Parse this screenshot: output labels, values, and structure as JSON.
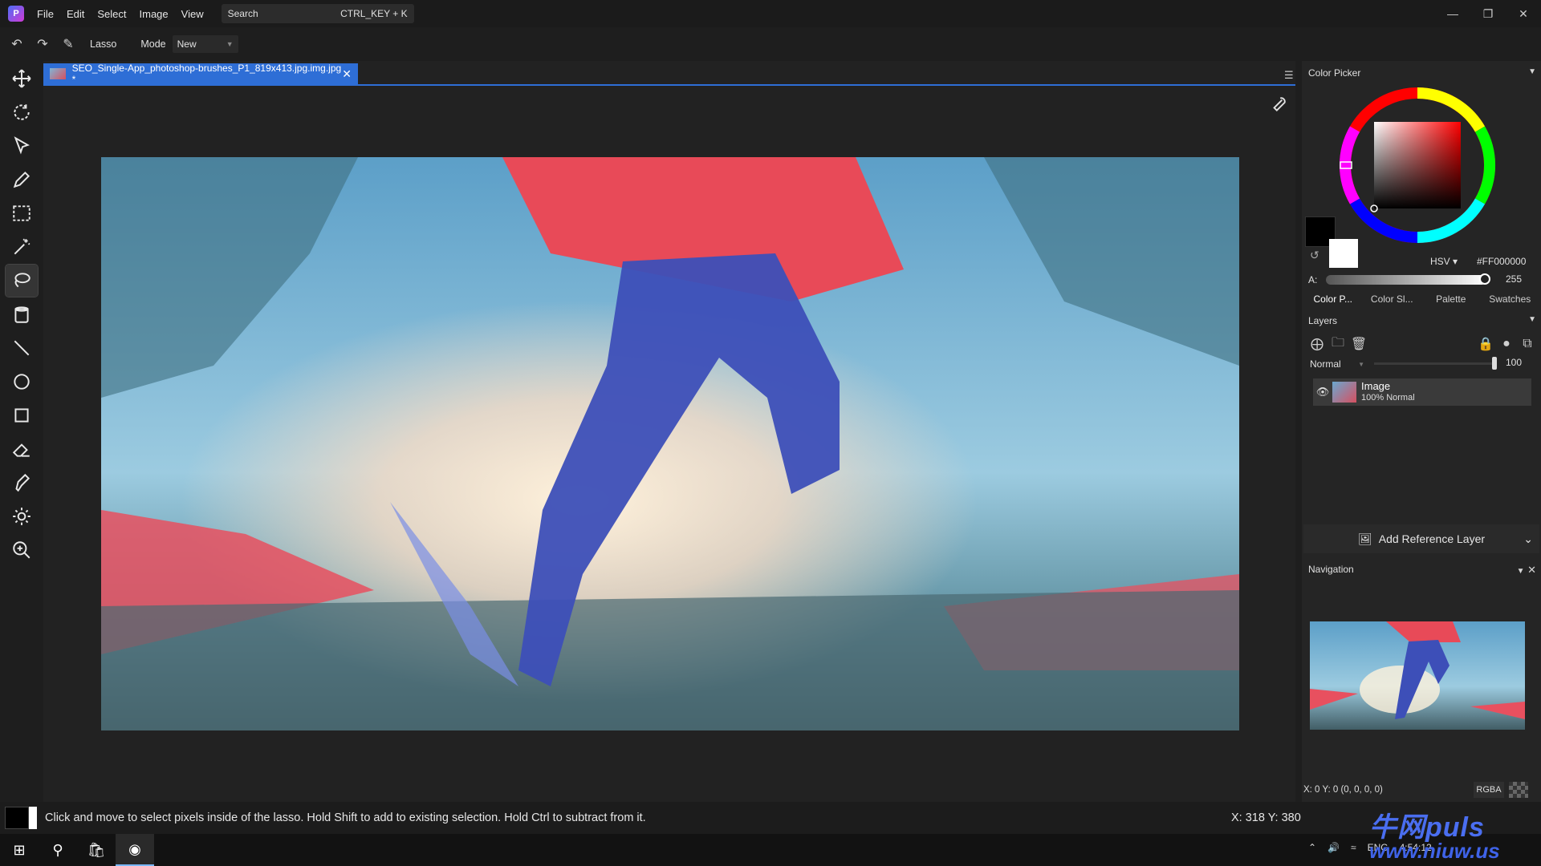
{
  "menu": {
    "items": [
      "File",
      "Edit",
      "Select",
      "Image",
      "View"
    ],
    "search_label": "Search",
    "search_shortcut": "CTRL_KEY + K"
  },
  "options": {
    "tool_name": "Lasso",
    "mode_label": "Mode",
    "mode_value": "New"
  },
  "tools": [
    "move-icon",
    "lasso-rotate-icon",
    "pointer-icon",
    "pencil-icon",
    "rect-select-icon",
    "magic-wand-icon",
    "lasso-icon",
    "bucket-icon",
    "line-icon",
    "ellipse-icon",
    "rectangle-icon",
    "eraser-icon",
    "pen-icon",
    "brightness-icon",
    "zoom-icon"
  ],
  "document": {
    "tab_title": "SEO_Single-App_photoshop-brushes_P1_819x413.jpg.img.jpg *",
    "tab_close": "✕"
  },
  "color_picker": {
    "title": "Color Picker",
    "mode": "HSV",
    "hex": "#FF000000",
    "alpha_label": "A:",
    "alpha_value": "255",
    "alpha_fraction": 1.0,
    "tabs": [
      "Color P...",
      "Color Sl...",
      "Palette",
      "Swatches"
    ],
    "foreground": "#000000",
    "background": "#ffffff"
  },
  "layers": {
    "title": "Layers",
    "blend_mode": "Normal",
    "opacity": "100",
    "items": [
      {
        "name": "Image",
        "details": "100%  Normal"
      }
    ],
    "add_reference_label": "Add Reference Layer"
  },
  "navigation": {
    "title": "Navigation",
    "readout": "X: 0 Y: 0    (0, 0, 0, 0)",
    "color_mode": "RGBA"
  },
  "status": {
    "hint": "Click and move to select pixels inside of the lasso. Hold Shift to add to existing selection. Hold Ctrl to subtract from it.",
    "coords": "X: 318 Y: 380"
  },
  "taskbar": {
    "tray_lang": "ENG",
    "tray_time": "4:54:12"
  },
  "watermark": {
    "title": "牛网puls",
    "url": "www.niuw.us"
  }
}
